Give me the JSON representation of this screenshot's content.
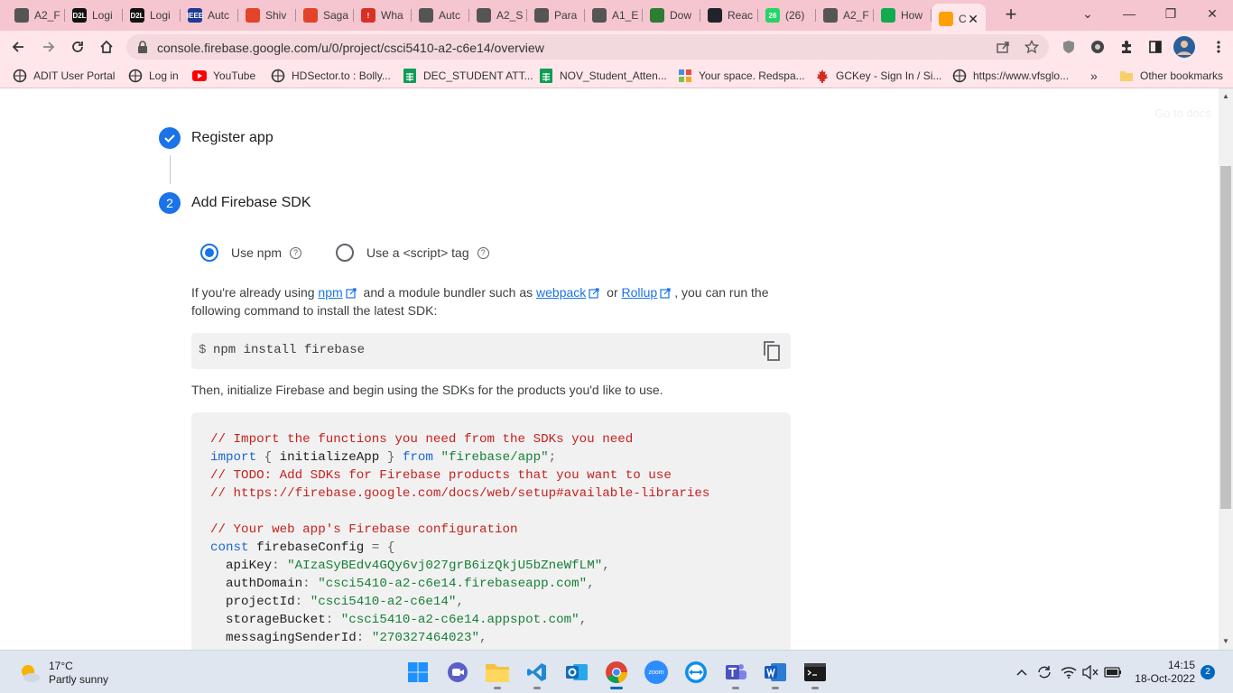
{
  "tabs": [
    {
      "label": "A2_F",
      "icon": "globe-icon",
      "color": "#555555"
    },
    {
      "label": "Logi",
      "icon": "d2l-icon",
      "color": "#111111",
      "badge": "D2L"
    },
    {
      "label": "Logi",
      "icon": "d2l-icon",
      "color": "#111111",
      "badge": "D2L"
    },
    {
      "label": "Autc",
      "icon": "ieee-icon",
      "color": "#1f3a93",
      "badge": "IEEE"
    },
    {
      "label": "Shiv",
      "icon": "gitlab-icon",
      "color": "#e24329"
    },
    {
      "label": "Saga",
      "icon": "gitlab-icon",
      "color": "#e24329"
    },
    {
      "label": "Wha",
      "icon": "alert-icon",
      "color": "#d93025",
      "badge": "!"
    },
    {
      "label": "Autc",
      "icon": "globe-icon",
      "color": "#555555"
    },
    {
      "label": "A2_S",
      "icon": "globe-icon",
      "color": "#555555"
    },
    {
      "label": "Para",
      "icon": "pencil-icon",
      "color": "#555555"
    },
    {
      "label": "A1_E",
      "icon": "globe-icon",
      "color": "#555555"
    },
    {
      "label": "Dow",
      "icon": "cube-icon",
      "color": "#2e7d32"
    },
    {
      "label": "Reac",
      "icon": "react-icon",
      "color": "#20232a"
    },
    {
      "label": "(26)",
      "icon": "whatsapp-icon",
      "color": "#25d366",
      "badge": "26"
    },
    {
      "label": "A2_F",
      "icon": "globe-icon",
      "color": "#555555"
    },
    {
      "label": "How",
      "icon": "mongo-icon",
      "color": "#13aa52"
    },
    {
      "label": "C",
      "icon": "firebase-icon",
      "color": "#ffa000",
      "active": true
    }
  ],
  "window": {
    "minimize": "—",
    "maximize": "❐",
    "close": "✕",
    "new_tab": "+",
    "tab_search": "⌄"
  },
  "address_bar": {
    "url": "console.firebase.google.com/u/0/project/csci5410-a2-c6e14/overview"
  },
  "bookmarks": [
    {
      "label": "ADIT User Portal",
      "icon": "globe-icon"
    },
    {
      "label": "Log in",
      "icon": "globe-icon"
    },
    {
      "label": "YouTube",
      "icon": "youtube-icon"
    },
    {
      "label": "HDSector.to : Bolly...",
      "icon": "globe-icon"
    },
    {
      "label": "DEC_STUDENT ATT...",
      "icon": "sheets-icon"
    },
    {
      "label": "NOV_Student_Atten...",
      "icon": "sheets-icon"
    },
    {
      "label": "Your space. Redspa...",
      "icon": "redspace-icon"
    },
    {
      "label": "GCKey - Sign In / Si...",
      "icon": "maple-leaf-icon"
    },
    {
      "label": "https://www.vfsglo...",
      "icon": "globe-icon"
    }
  ],
  "bookmarks_more": "»",
  "other_bookmarks": "Other bookmarks",
  "page": {
    "docs_link": "Go to docs",
    "step1": {
      "title": "Register app"
    },
    "step2": {
      "number": "2",
      "title": "Add Firebase SDK"
    },
    "radio_npm": {
      "label": "Use npm",
      "selected": true
    },
    "radio_script": {
      "label": "Use a <script> tag",
      "selected": false
    },
    "intro": {
      "t1": "If you're already using ",
      "npm": "npm",
      "t2": " and a module bundler such as ",
      "webpack": "webpack",
      "t3": " or ",
      "rollup": "Rollup",
      "t4": ", you can run the following command to install the latest SDK:"
    },
    "install": {
      "prompt": "$",
      "command": "npm install firebase"
    },
    "then_text": "Then, initialize Firebase and begin using the SDKs for the products you'd like to use.",
    "code": {
      "c1": "// Import the functions you need from the SDKs you need",
      "import_kw": "import",
      "import_open": " { ",
      "import_name": "initializeApp",
      "import_close": " } ",
      "from_kw": "from",
      "import_src": "\"firebase/app\"",
      "semi": ";",
      "c2": "// TODO: Add SDKs for Firebase products that you want to use",
      "c3": "// https://firebase.google.com/docs/web/setup#available-libraries",
      "c4": "// Your web app's Firebase configuration",
      "const_kw": "const",
      "config_name": "firebaseConfig",
      "config_open": " = {",
      "apiKey_k": "apiKey",
      "apiKey_v": "\"AIzaSyBEdv4GQy6vj027grB6izQkjU5bZneWfLM\"",
      "authDomain_k": "authDomain",
      "authDomain_v": "\"csci5410-a2-c6e14.firebaseapp.com\"",
      "projectId_k": "projectId",
      "projectId_v": "\"csci5410-a2-c6e14\"",
      "storageBucket_k": "storageBucket",
      "storageBucket_v": "\"csci5410-a2-c6e14.appspot.com\"",
      "messagingSenderId_k": "messagingSenderId",
      "messagingSenderId_v": "\"270327464023\"",
      "colon": ": ",
      "comma": ","
    }
  },
  "taskbar": {
    "weather_temp": "17°C",
    "weather_desc": "Partly sunny",
    "time": "14:15",
    "date": "18-Oct-2022",
    "notifications": "2",
    "zoom_label": "zoom",
    "apps": [
      "windows-start-icon",
      "meet-icon",
      "file-explorer-icon",
      "vscode-icon",
      "outlook-icon",
      "chrome-icon",
      "zoom-icon",
      "teamviewer-icon",
      "teams-icon",
      "word-icon",
      "terminal-icon"
    ]
  },
  "colors": {
    "tabstrip": "#f5c6cf",
    "toolbar": "#ffe6eb",
    "firebase_blue": "#1a73e8",
    "taskbar": "#dfe6ef"
  }
}
